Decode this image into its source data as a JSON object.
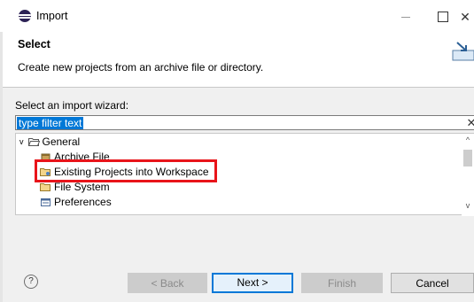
{
  "window": {
    "title": "Import"
  },
  "header": {
    "title": "Select",
    "description": "Create new projects from an archive file or directory."
  },
  "wizard": {
    "label": "Select an import wizard:",
    "filter": {
      "value": "type filter text"
    },
    "tree": [
      {
        "label": "General",
        "expanded": true,
        "level": 0
      },
      {
        "label": "Archive File",
        "level": 1
      },
      {
        "label": "Existing Projects into Workspace",
        "level": 1,
        "highlighted": true
      },
      {
        "label": "File System",
        "level": 1
      },
      {
        "label": "Preferences",
        "level": 1
      }
    ]
  },
  "buttons": {
    "back": "< Back",
    "next": "Next >",
    "finish": "Finish",
    "cancel": "Cancel"
  },
  "colors": {
    "selection": "#0078d7",
    "highlight_box": "#e8141a"
  }
}
